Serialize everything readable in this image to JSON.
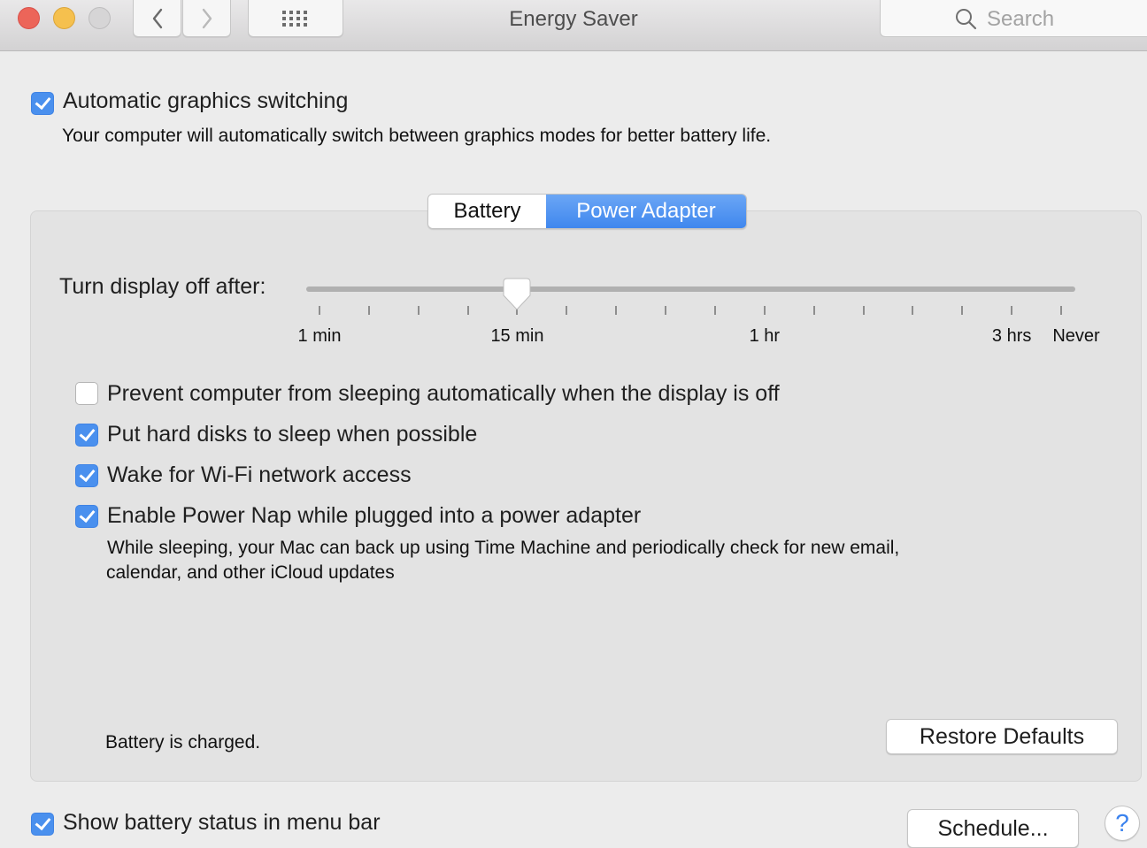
{
  "window": {
    "title": "Energy Saver",
    "search_placeholder": "Search"
  },
  "toolbar": {
    "back_icon": "chevron-left-icon",
    "forward_icon": "chevron-right-icon",
    "grid_icon": "show-all-grid-icon"
  },
  "graphics_switching": {
    "label": "Automatic graphics switching",
    "checked": true,
    "description": "Your computer will automatically switch between graphics modes for better battery life."
  },
  "tabs": [
    {
      "label": "Battery",
      "selected": false
    },
    {
      "label": "Power Adapter",
      "selected": true
    }
  ],
  "display_sleep": {
    "label": "Turn display off after:",
    "value": "15 min",
    "value_tick_index": 4,
    "tick_count": 16,
    "tick_labels": [
      {
        "label": "1 min",
        "tick": 0
      },
      {
        "label": "15 min",
        "tick": 4
      },
      {
        "label": "1 hr",
        "tick": 9
      },
      {
        "label": "3 hrs",
        "tick": 14
      },
      {
        "label": "Never",
        "tick": 15
      }
    ]
  },
  "options": [
    {
      "label": "Prevent computer from sleeping automatically when the display is off",
      "checked": false
    },
    {
      "label": "Put hard disks to sleep when possible",
      "checked": true
    },
    {
      "label": "Wake for Wi-Fi network access",
      "checked": true
    },
    {
      "label": "Enable Power Nap while plugged into a power adapter",
      "checked": true,
      "description_line1": "While sleeping, your Mac can back up using Time Machine and periodically check for new email,",
      "description_line2": "calendar, and other iCloud updates"
    }
  ],
  "status": "Battery is charged.",
  "restore_defaults_label": "Restore Defaults",
  "show_battery_status": {
    "label": "Show battery status in menu bar",
    "checked": true
  },
  "schedule_label": "Schedule...",
  "help_label": "?",
  "colors": {
    "accent": "#4a90ee",
    "close": "#ec6559",
    "minimize": "#f5c04e",
    "zoom_disabled": "#d6d5d6"
  }
}
